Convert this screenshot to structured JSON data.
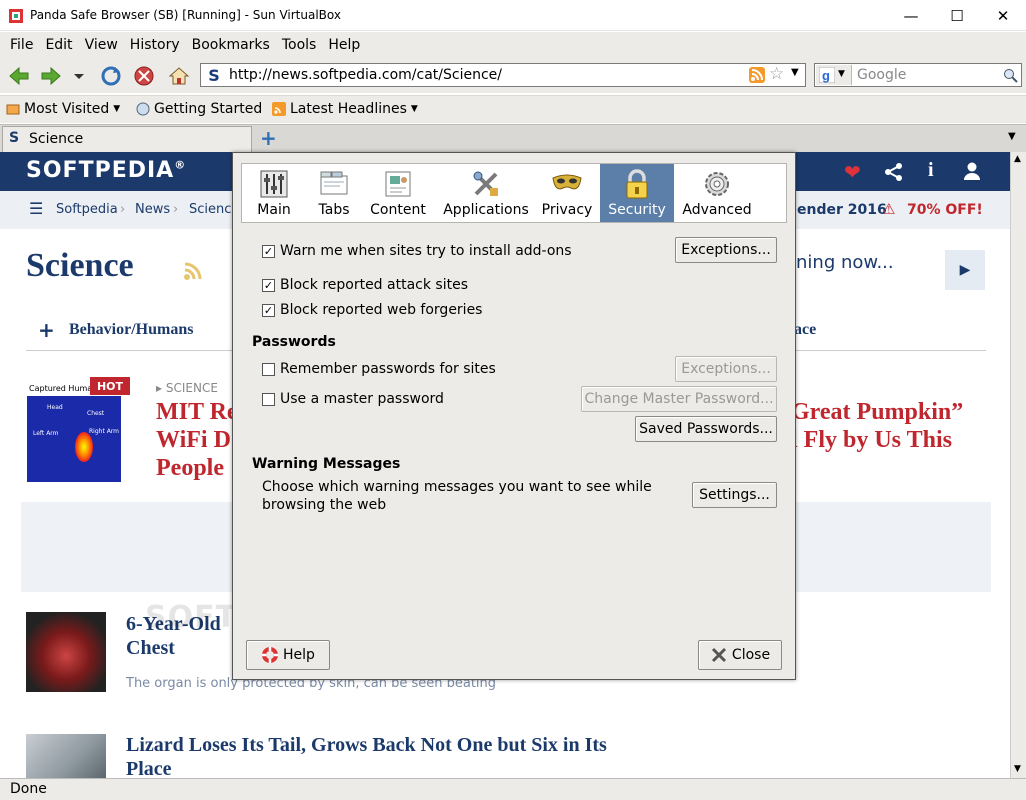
{
  "window": {
    "title": "Panda Safe Browser (SB) [Running] - Sun VirtualBox"
  },
  "menu": [
    "File",
    "Edit",
    "View",
    "History",
    "Bookmarks",
    "Tools",
    "Help"
  ],
  "nav": {
    "url": "http://news.softpedia.com/cat/Science/",
    "search_placeholder": "Google"
  },
  "bookmarks": [
    "Most Visited",
    "Getting Started",
    "Latest Headlines"
  ],
  "tab": {
    "label": "Science"
  },
  "page": {
    "logo": "SOFTPEDIA",
    "logo_mark": "®",
    "breadcrumb": [
      "Softpedia",
      "News",
      "Science"
    ],
    "promo": "ender 2016",
    "promo_off": "70% OFF!",
    "heading": "Science",
    "teaser": "ning now...",
    "cat_left": "Behavior/Humans",
    "cat_right": "ace",
    "hot": "HOT",
    "hot_category": "SCIENCE",
    "thumb_caption": "Captured Human",
    "thumb_labels": [
      "Head",
      "Chest",
      "Left Arm",
      "Right Arm"
    ],
    "art1_lines": [
      "MIT Re",
      "WiFi D",
      "People"
    ],
    "art2_lines": [
      "Great Pumpkin”",
      "l Fly by Us This"
    ],
    "art3_title": [
      "6-Year-Old",
      "Chest"
    ],
    "art3_sub": "The organ is only protected by skin, can be seen beating",
    "art4_title": "Lizard Loses Its Tail, Grows Back Not One but Six in Its",
    "art4_title2": "Place",
    "watermark": "SOFTPEDIA"
  },
  "dialog": {
    "panes": [
      "Main",
      "Tabs",
      "Content",
      "Applications",
      "Privacy",
      "Security",
      "Advanced"
    ],
    "selected_pane": "Security",
    "warn_addons": "Warn me when sites try to install add-ons",
    "block_attack": "Block reported attack sites",
    "block_forgery": "Block reported web forgeries",
    "exceptions": "Exceptions...",
    "passwords_header": "Passwords",
    "remember_pw": "Remember passwords for sites",
    "master_pw": "Use a master password",
    "change_master": "Change Master Password...",
    "saved_pw": "Saved Passwords...",
    "warning_header": "Warning Messages",
    "warning_text1": "Choose which warning messages you want to see while",
    "warning_text2": "browsing the web",
    "settings": "Settings...",
    "help": "Help",
    "close": "Close"
  },
  "status": "Done",
  "colors": {
    "brand": "#1b3a6b",
    "accent_red": "#c0262d",
    "selected_pane": "#5b7fa9"
  }
}
